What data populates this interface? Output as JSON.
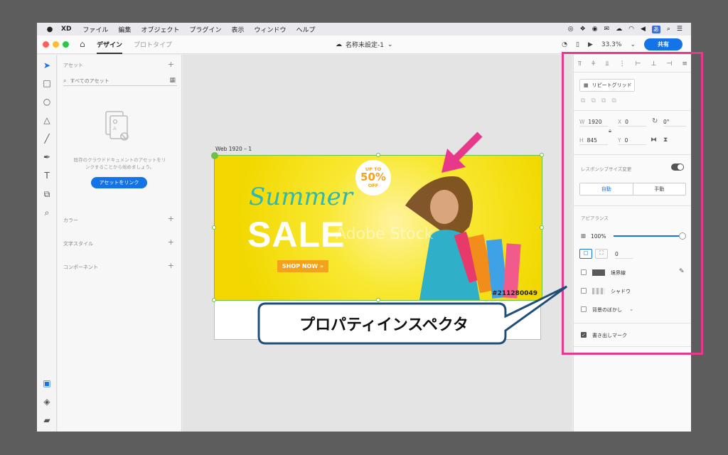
{
  "menubar": {
    "app": "XD",
    "items": [
      "ファイル",
      "編集",
      "オブジェクト",
      "プラグイン",
      "表示",
      "ウィンドウ",
      "ヘルプ"
    ],
    "input_indicator": "あ"
  },
  "titlebar": {
    "tab_design": "デザイン",
    "tab_prototype": "プロトタイプ",
    "document_title": "名称未設定-1",
    "zoom": "33.3%",
    "share_label": "共有"
  },
  "assets": {
    "header": "アセット",
    "search_placeholder": "すべてのアセット",
    "description": "既存のクラウドドキュメントのアセットをリンクすることから始めましょう。",
    "link_button": "アセットをリンク",
    "sections": [
      "カラー",
      "文字スタイル",
      "コンポーネント"
    ]
  },
  "canvas": {
    "artboard_name": "Web 1920 – 1",
    "banner": {
      "badge_top": "UP TO",
      "badge_value": "50%",
      "badge_bottom": "OFF",
      "headline_script": "Summer",
      "headline": "SALE",
      "cta": "SHOP NOW »",
      "watermark": "Adobe Stock",
      "stock_id": "#211280049"
    }
  },
  "callout": {
    "text": "プロパティインスペクタ"
  },
  "inspector": {
    "repeat_grid": "リピートグリッド",
    "w_label": "W",
    "w_value": "1920",
    "h_label": "H",
    "h_value": "845",
    "x_label": "X",
    "x_value": "0",
    "y_label": "Y",
    "y_value": "0",
    "rotation_value": "0°",
    "responsive_label": "レスポンシブサイズ変更",
    "responsive_on": true,
    "seg_auto": "自動",
    "seg_manual": "手動",
    "appearance_label": "アピアランス",
    "opacity_value": "100%",
    "corner_value": "0",
    "border_label": "境界線",
    "shadow_label": "シャドウ",
    "bg_blur_label": "背景のぼかし",
    "export_label": "書き出しマーク"
  },
  "colors": {
    "accent_blue": "#1473e6",
    "highlight_pink": "#e8388c",
    "selection_green": "#6fc04a",
    "callout_border": "#1f4e79"
  }
}
